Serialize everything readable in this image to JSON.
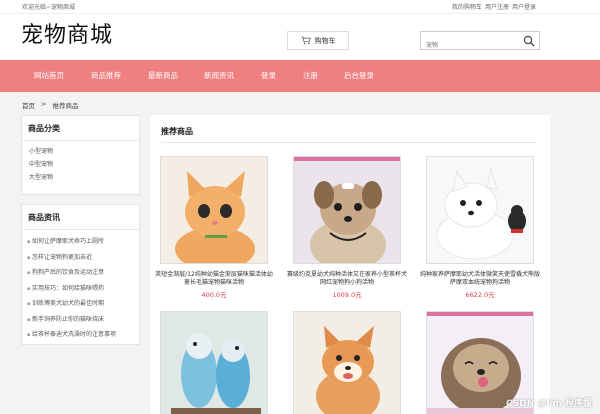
{
  "topbar": {
    "welcome": "欢迎光临~宠物商城",
    "links": [
      "我的购物车",
      "用户注册",
      "用户登录"
    ]
  },
  "header": {
    "logo": "宠物商城",
    "cart_label": "购物车",
    "search_placeholder": "宠物"
  },
  "nav": {
    "items": [
      "网站首页",
      "商品推荐",
      "最新商品",
      "新闻资讯",
      "登录",
      "注册",
      "后台登录"
    ]
  },
  "breadcrumb": {
    "home": "首页",
    "sep": ">",
    "current": "推荐商品"
  },
  "sidebar": {
    "categories_title": "商品分类",
    "categories": [
      "小型宠物",
      "中型宠物",
      "大型宠物"
    ],
    "news_title": "商品资讯",
    "news": [
      "如何让萨摩耶犬乖巧上厕所",
      "怎样让宠物狗更加亲近",
      "狗狗产后的饮食及运动注意",
      "实用技巧：如何给猫咪喂药",
      "训练博美犬幼犬的最佳时期",
      "新手饲养防止你的猫咪挠床",
      "给茶杯泰迪犬洗澡时的注意事项"
    ]
  },
  "main": {
    "title": "推荐商品",
    "products": [
      {
        "name": "英短金渐层/12纯种幼猫金渐层猫咪猫活体幼崽长毛猫宠物猫咪活物",
        "price": "400.0元"
      },
      {
        "name": "赛级约克夏幼犬纯种活体又在家养小型茶杯犬网红宠物狗小狗活物",
        "price": "1009.0元"
      },
      {
        "name": "纯种家养萨摩耶幼犬活体微笑天使雪橇犬熊版萨摩双血统宠物狗活物",
        "price": "6622.0元"
      },
      {
        "name": "",
        "price": ""
      },
      {
        "name": "",
        "price": ""
      },
      {
        "name": "",
        "price": ""
      }
    ]
  },
  "watermark": "CSDN @I'm 程序媛",
  "colors": {
    "nav_bg": "#f08080",
    "price": "#e04040"
  }
}
